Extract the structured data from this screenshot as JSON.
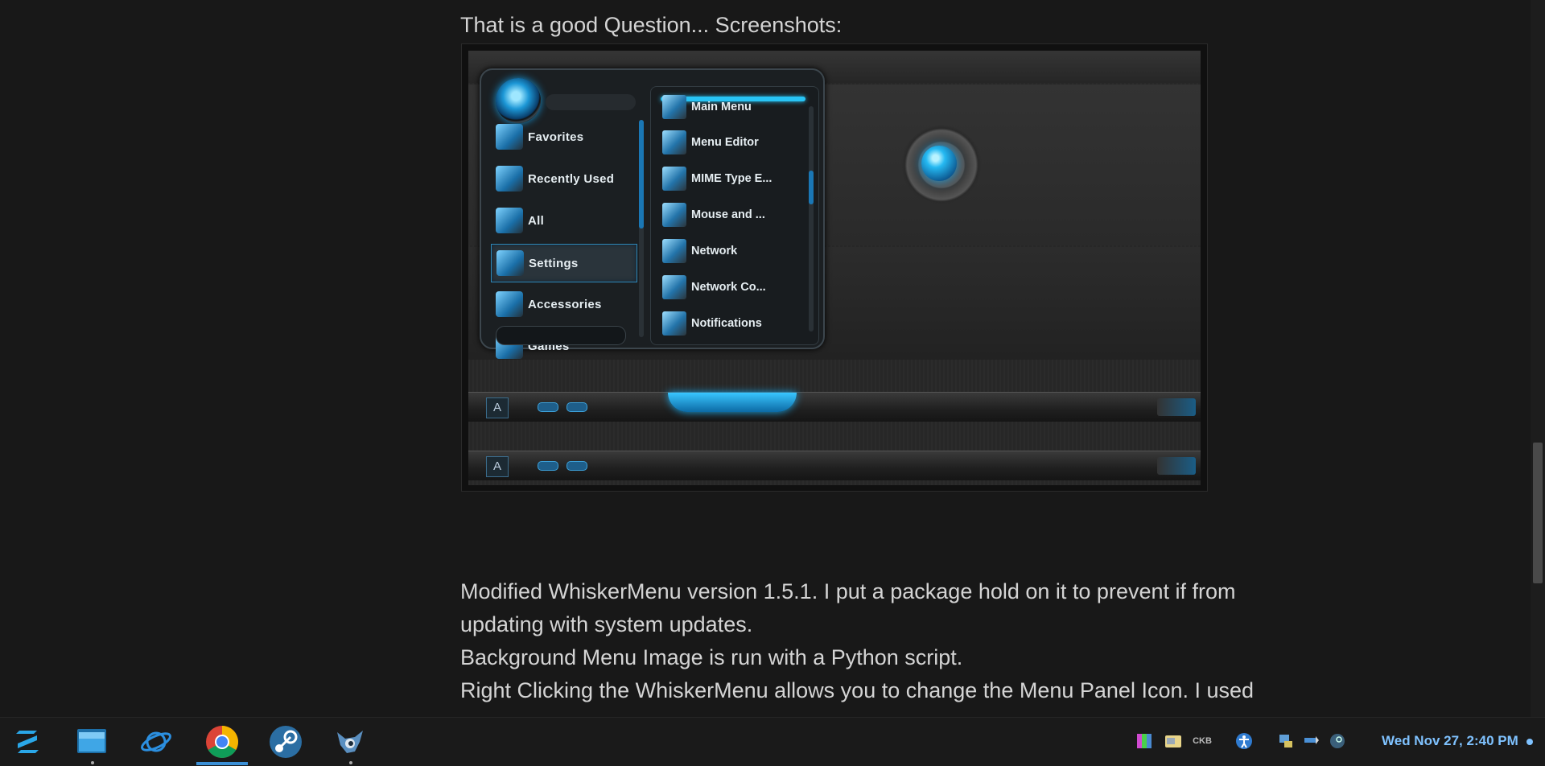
{
  "post": {
    "intro": "That is a good Question... Screenshots:",
    "paragraphs": [
      "Modified WhiskerMenu version 1.5.1. I put a package hold on it to prevent if from",
      "updating with system updates.",
      "Background Menu Image is run with a Python script.",
      "Right Clicking the WhiskerMenu allows you to change the Menu Panel Icon. I used"
    ]
  },
  "screenshot": {
    "categories": [
      {
        "label": "Favorites"
      },
      {
        "label": "Recently Used"
      },
      {
        "label": "All"
      },
      {
        "label": "Settings",
        "selected": true
      },
      {
        "label": "Accessories"
      },
      {
        "label": "Games"
      }
    ],
    "apps": [
      {
        "label": "Main Menu"
      },
      {
        "label": "Menu Editor"
      },
      {
        "label": "MIME Type E..."
      },
      {
        "label": "Mouse and ..."
      },
      {
        "label": "Network"
      },
      {
        "label": "Network Co..."
      },
      {
        "label": "Notifications"
      }
    ],
    "panel_launcher_glyph": "A"
  },
  "taskbar": {
    "apps": [
      {
        "name": "zorin-menu-icon"
      },
      {
        "name": "files-icon"
      },
      {
        "name": "browser-planet-icon"
      },
      {
        "name": "chrome-icon",
        "active": true
      },
      {
        "name": "steam-icon"
      },
      {
        "name": "gimp-icon"
      }
    ],
    "tray": {
      "keyboard_layout": "CKB"
    },
    "clock": "Wed Nov 27,  2:40 PM"
  },
  "colors": {
    "accent": "#28c4f5",
    "clock": "#7fc2ff",
    "background": "#181818"
  }
}
